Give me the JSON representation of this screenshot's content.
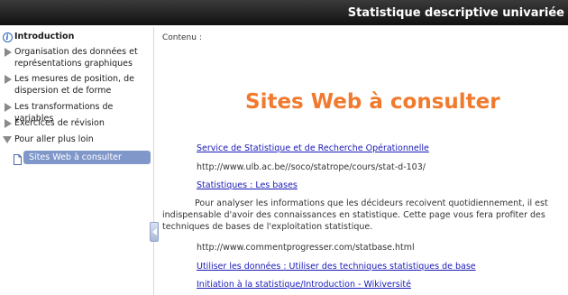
{
  "header": {
    "title": "Statistique descriptive univariée"
  },
  "sidebar": {
    "items": [
      {
        "label": "Introduction"
      },
      {
        "label": "Organisation des données et représentations graphiques"
      },
      {
        "label": "Les mesures de position, de dispersion et de forme"
      },
      {
        "label": "Les transformations de variables"
      },
      {
        "label": "Exercices de révision"
      },
      {
        "label": "Pour aller plus loin"
      }
    ],
    "selected_child": "Sites Web à consulter"
  },
  "main": {
    "content_label": "Contenu :",
    "heading": "Sites Web à consulter",
    "link1": "Service de Statistique et de Recherche Opérationnelle",
    "url1": "http://www.ulb.ac.be//soco/statrope/cours/stat-d-103/",
    "link2": "Statistiques : Les bases",
    "paragraph": "Pour analyser les informations que les décideurs recoivent quotidiennement, il est indispensable d'avoir des connaissances en statistique. Cette page vous fera profiter des techniques de bases de l'exploitation statistique.",
    "url2": "http://www.commentprogresser.com/statbase.html",
    "link3": "Utiliser les données : Utiliser des techniques statistiques de base",
    "link4": "Initiation à la statistique/Introduction - Wikiversité"
  },
  "colors": {
    "accent": "#f07a2e",
    "selection": "#7f97c9",
    "link": "#1a1ab8"
  }
}
